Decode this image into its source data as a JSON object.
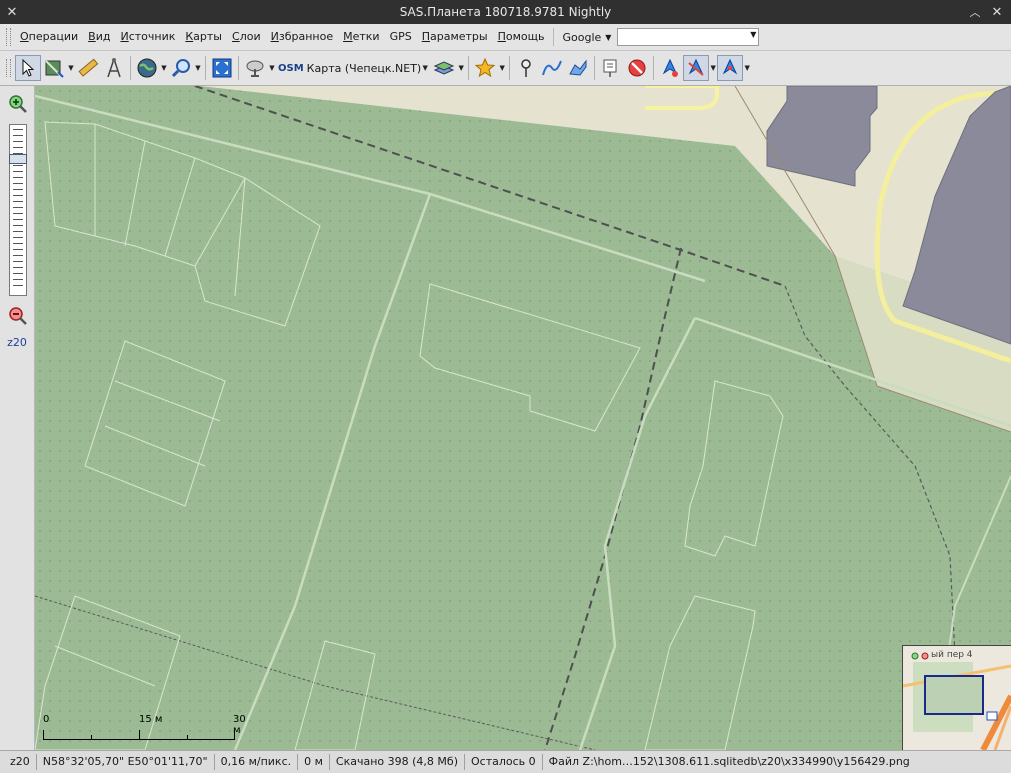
{
  "window": {
    "title": "SAS.Планета 180718.9781 Nightly"
  },
  "menu": {
    "items": [
      "Операции",
      "Вид",
      "Источник",
      "Карты",
      "Слои",
      "Избранное",
      "Метки",
      "GPS",
      "Параметры",
      "Помощь"
    ],
    "search_engine": "Google",
    "search_value": ""
  },
  "toolbar": {
    "map_source_badge": "OSM",
    "map_source_label": "Карта (Чепецк.NET)"
  },
  "zoom": {
    "level": "z20"
  },
  "scale": {
    "labels": [
      "0",
      "15 м",
      "30 м"
    ]
  },
  "minimap": {
    "street_label": "ый пер 4"
  },
  "status": {
    "zoom": "z20",
    "coords": "N58°32'05,70\" E50°01'11,70\"",
    "resolution": "0,16 м/пикс.",
    "distance": "0 м",
    "downloaded": "Скачано 398 (4,8 Мб)",
    "remaining": "Осталось 0",
    "file": "Файл Z:\\hom…152\\1308.611.sqlitedb\\z20\\x334990\\y156429.png"
  },
  "colors": {
    "map_green": "#9cba94",
    "road_cream": "#f2efd9",
    "building_gray": "#8a8a9a"
  },
  "icons": {
    "select": "cursor-arrow-icon",
    "layer_select": "layer-select-icon",
    "ruler": "ruler-icon",
    "compass": "compass-icon",
    "globe": "globe-icon",
    "search": "magnifier-icon",
    "fullscreen": "fullscreen-icon",
    "gps": "satellite-dish-icon",
    "layers": "layers-icon",
    "favorites": "star-icon",
    "placemark": "placemark-icon",
    "path": "path-icon",
    "polygon": "polygon-icon",
    "notes": "marks-list-icon",
    "hide_marks": "no-marks-icon",
    "gps_track": "gps-track-icon",
    "gps_connect": "gps-connect-icon",
    "gps_center": "gps-center-icon"
  }
}
